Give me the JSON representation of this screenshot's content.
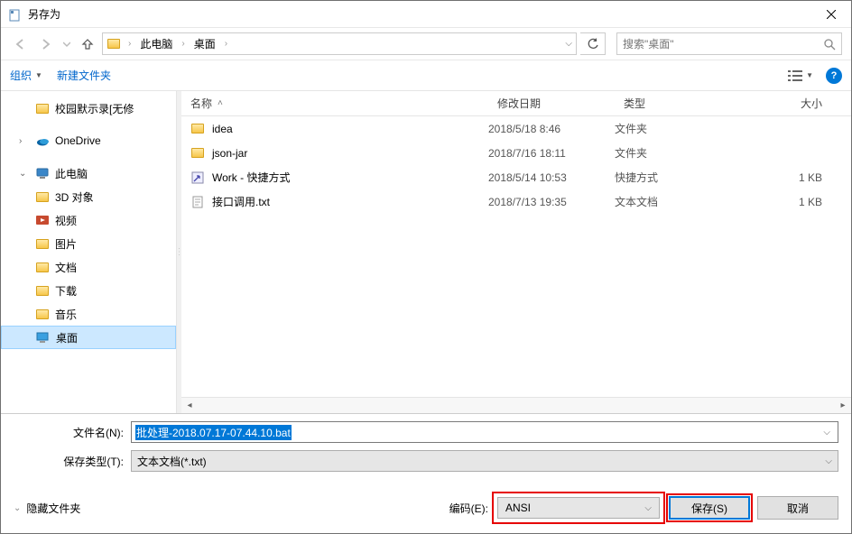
{
  "title": "另存为",
  "breadcrumb": {
    "root": "此电脑",
    "current": "桌面"
  },
  "search_placeholder": "搜索\"桌面\"",
  "toolbar": {
    "organize": "组织",
    "newfolder": "新建文件夹"
  },
  "columns": {
    "name": "名称",
    "modified": "修改日期",
    "type": "类型",
    "size": "大小"
  },
  "sidebar": {
    "unknownFolder": "校园默示录[无修",
    "onedrive": "OneDrive",
    "thispc": "此电脑",
    "items": [
      {
        "label": "3D 对象"
      },
      {
        "label": "视频"
      },
      {
        "label": "图片"
      },
      {
        "label": "文档"
      },
      {
        "label": "下载"
      },
      {
        "label": "音乐"
      },
      {
        "label": "桌面"
      }
    ]
  },
  "rows": [
    {
      "name": "idea",
      "date": "2018/5/18 8:46",
      "type": "文件夹",
      "size": "",
      "icon": "folder"
    },
    {
      "name": "json-jar",
      "date": "2018/7/16 18:11",
      "type": "文件夹",
      "size": "",
      "icon": "folder"
    },
    {
      "name": "Work - 快捷方式",
      "date": "2018/5/14 10:53",
      "type": "快捷方式",
      "size": "1 KB",
      "icon": "shortcut"
    },
    {
      "name": "接口调用.txt",
      "date": "2018/7/13 19:35",
      "type": "文本文档",
      "size": "1 KB",
      "icon": "text"
    }
  ],
  "form": {
    "filename_label": "文件名(N):",
    "filename_value": "批处理-2018.07.17-07.44.10.bat",
    "filetype_label": "保存类型(T):",
    "filetype_value": "文本文档(*.txt)"
  },
  "footer": {
    "hide_folders": "隐藏文件夹",
    "encoding_label": "编码(E):",
    "encoding_value": "ANSI",
    "save": "保存(S)",
    "cancel": "取消"
  }
}
